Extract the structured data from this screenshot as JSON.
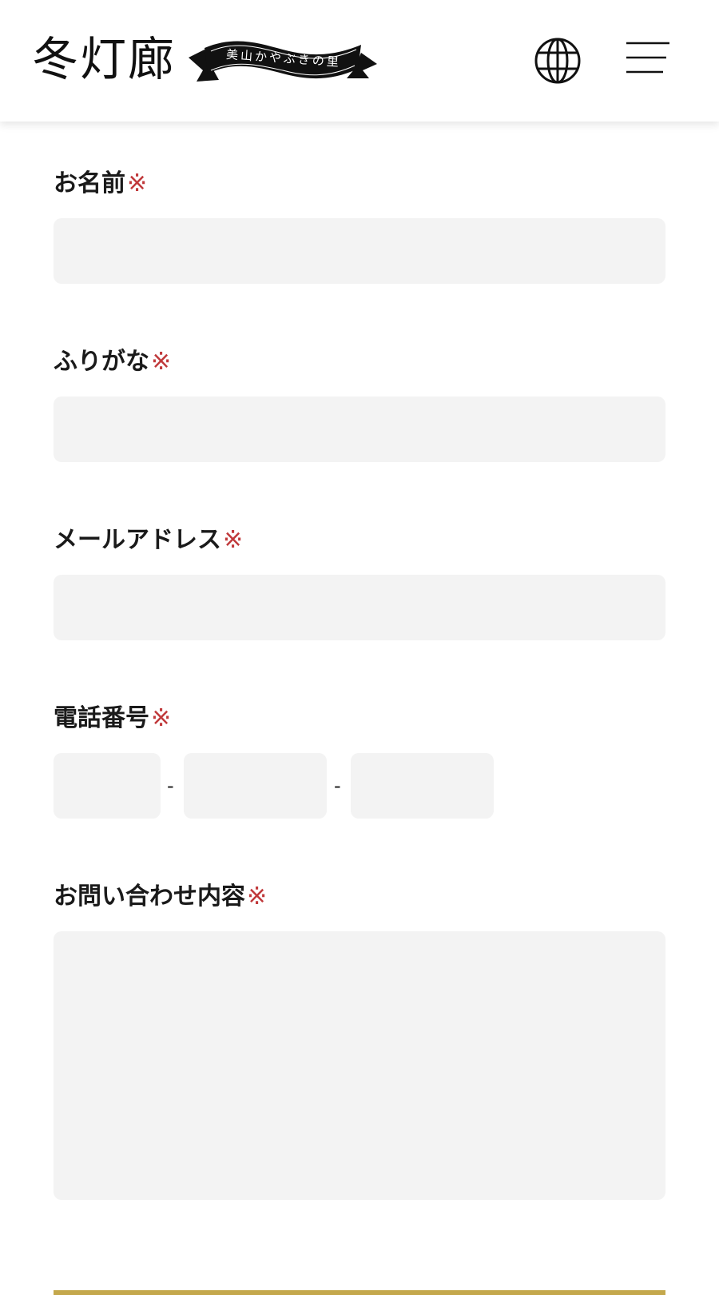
{
  "header": {
    "logo_text": "冬灯廊",
    "ribbon_text": "美山かやぶきの里",
    "language_icon": "globe-icon",
    "menu_icon": "hamburger-menu-icon"
  },
  "form": {
    "required_mark": "※",
    "name": {
      "label": "お名前",
      "value": "",
      "placeholder": ""
    },
    "furigana": {
      "label": "ふりがな",
      "value": "",
      "placeholder": ""
    },
    "email": {
      "label": "メールアドレス",
      "value": "",
      "placeholder": ""
    },
    "phone": {
      "label": "電話番号",
      "separator": "-",
      "part1": "",
      "part2": "",
      "part3": ""
    },
    "message": {
      "label": "お問い合わせ内容",
      "value": "",
      "placeholder": ""
    }
  },
  "colors": {
    "required": "#c0393b",
    "field_bg": "#f3f3f3",
    "accent_gold": "#c4a84c",
    "text": "#1a1a1a"
  }
}
